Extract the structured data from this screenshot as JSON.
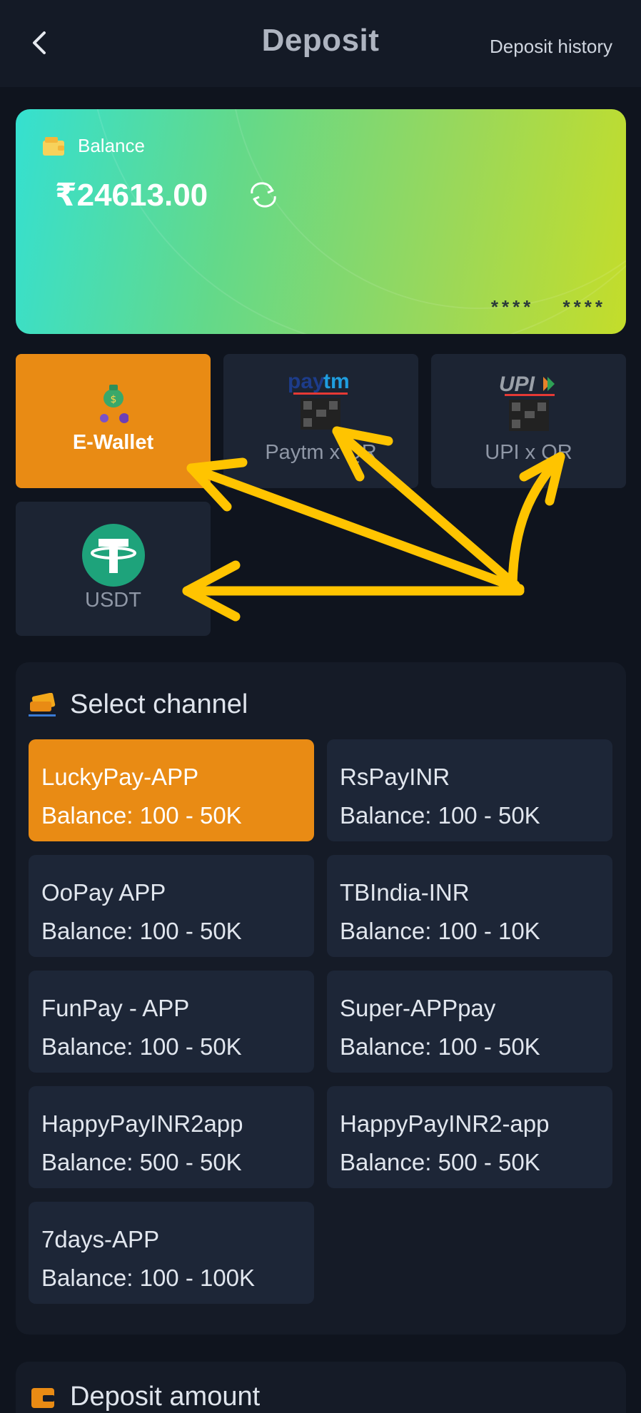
{
  "header": {
    "title": "Deposit",
    "history_label": "Deposit history"
  },
  "balance": {
    "label": "Balance",
    "amount": "₹24613.00",
    "masked": "****  ****"
  },
  "methods": [
    {
      "label": "E-Wallet",
      "active": true,
      "icon": "money-bag-icon"
    },
    {
      "label": "Paytm x QR",
      "active": false,
      "icon": "paytm-qr-icon"
    },
    {
      "label": "UPI x QR",
      "active": false,
      "icon": "upi-qr-icon"
    },
    {
      "label": "USDT",
      "active": false,
      "icon": "tether-icon"
    }
  ],
  "channel_section": {
    "title": "Select channel",
    "channels": [
      {
        "name": "LuckyPay-APP",
        "range": "Balance: 100 - 50K",
        "active": true
      },
      {
        "name": "RsPayINR",
        "range": "Balance: 100 - 50K",
        "active": false
      },
      {
        "name": "OoPay APP",
        "range": "Balance: 100 - 50K",
        "active": false
      },
      {
        "name": "TBIndia-INR",
        "range": "Balance: 100 - 10K",
        "active": false
      },
      {
        "name": "FunPay - APP",
        "range": "Balance: 100 - 50K",
        "active": false
      },
      {
        "name": "Super-APPpay",
        "range": "Balance: 100 - 50K",
        "active": false
      },
      {
        "name": "HappyPayINR2app",
        "range": "Balance: 500 - 50K",
        "active": false
      },
      {
        "name": "HappyPayINR2-app",
        "range": "Balance: 500 - 50K",
        "active": false
      },
      {
        "name": "7days-APP",
        "range": "Balance: 100 - 100K",
        "active": false
      }
    ]
  },
  "amount_section": {
    "title": "Deposit amount"
  },
  "colors": {
    "accent": "#e98b14",
    "arrow": "#ffc400",
    "background": "#0f141e",
    "card_bg": "#1c2433"
  }
}
